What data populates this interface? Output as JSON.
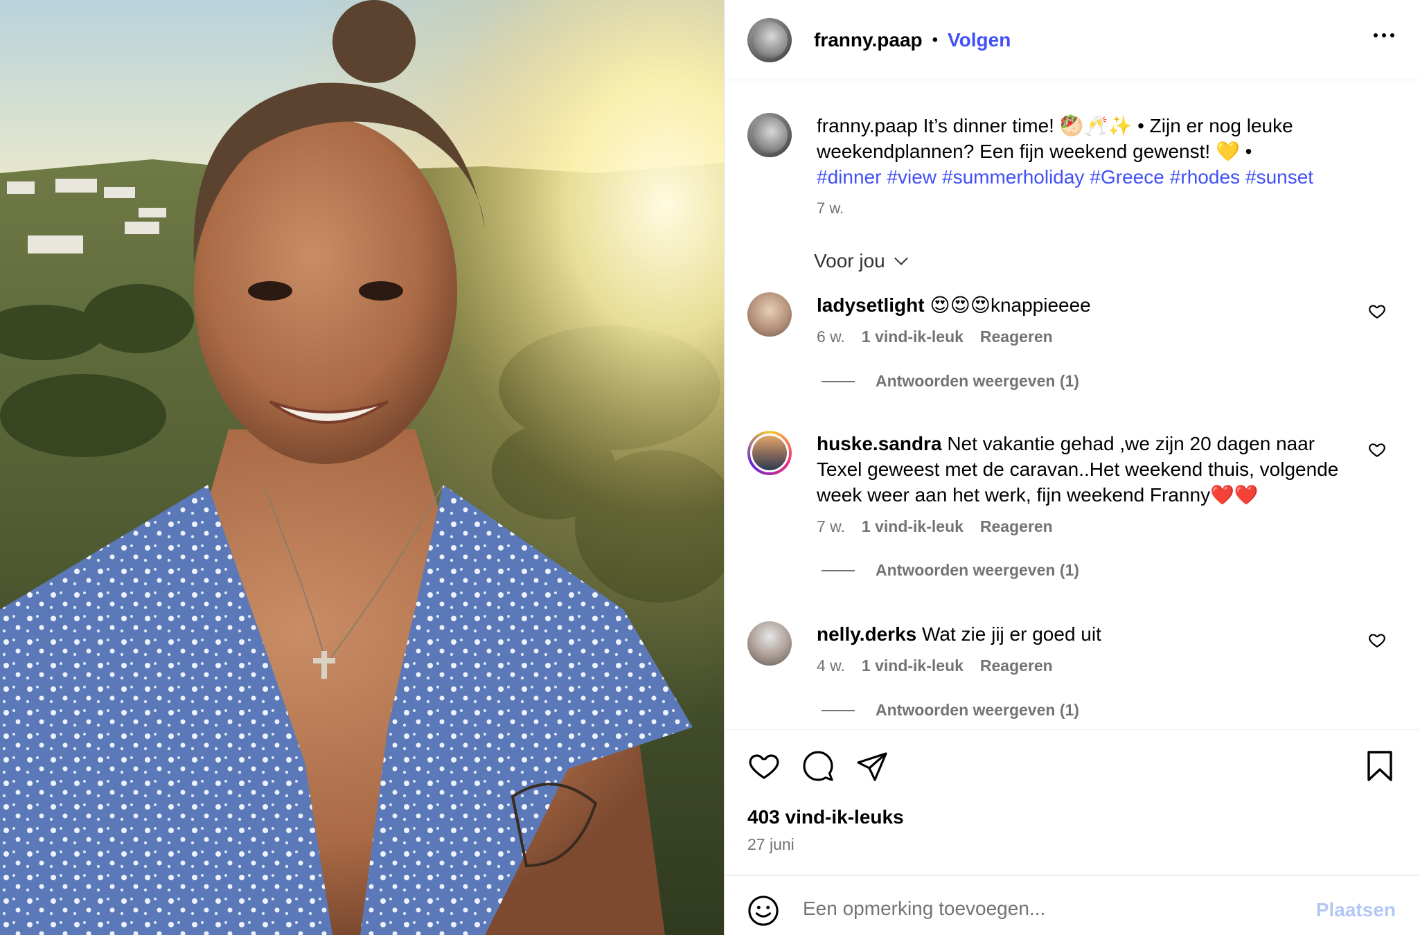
{
  "post": {
    "username": "franny.paap",
    "follow_label": "Volgen",
    "separator": "•",
    "more_icon": "more-horizontal-icon",
    "photo_alt": "Selfie of smiling woman at sunset over a green Greek hillside"
  },
  "caption": {
    "username": "franny.paap",
    "text": "It’s dinner time! 🥙🥂✨ • Zijn er nog leuke weekendplannen? Een fijn weekend gewenst! 💛 •",
    "hashtags": [
      "#dinner",
      "#view",
      "#summerholiday",
      "#Greece",
      "#rhodes",
      "#sunset"
    ],
    "time": "7 w."
  },
  "sort": {
    "label": "Voor jou",
    "icon": "chevron-down-icon"
  },
  "comments": [
    {
      "username": "ladysetlight",
      "text": "😍😍😍knappieeee",
      "time": "6 w.",
      "likes": "1 vind-ik-leuk",
      "reply": "Reageren",
      "replies_label": "Antwoorden weergeven (1)"
    },
    {
      "username": "huske.sandra",
      "text": "Net vakantie gehad ,we zijn 20 dagen naar Texel geweest met de caravan..Het weekend thuis, volgende week weer aan het werk, fijn weekend Franny❤️❤️",
      "time": "7 w.",
      "likes": "1 vind-ik-leuk",
      "reply": "Reageren",
      "replies_label": "Antwoorden weergeven (1)"
    },
    {
      "username": "nelly.derks",
      "text": "Wat zie jij er goed uit",
      "time": "4 w.",
      "likes": "1 vind-ik-leuk",
      "reply": "Reageren",
      "replies_label": "Antwoorden weergeven (1)"
    }
  ],
  "actions": {
    "like_icon": "heart-icon",
    "comment_icon": "comment-icon",
    "share_icon": "send-icon",
    "save_icon": "bookmark-icon",
    "likes_count": "403 vind-ik-leuks",
    "date": "27 juni"
  },
  "add_comment": {
    "placeholder": "Een opmerking toevoegen...",
    "post_label": "Plaatsen",
    "emoji_icon": "emoji-icon"
  },
  "colors": {
    "link_blue": "#4150f7",
    "muted": "#737373",
    "post_disabled": "#b3c8f7"
  }
}
